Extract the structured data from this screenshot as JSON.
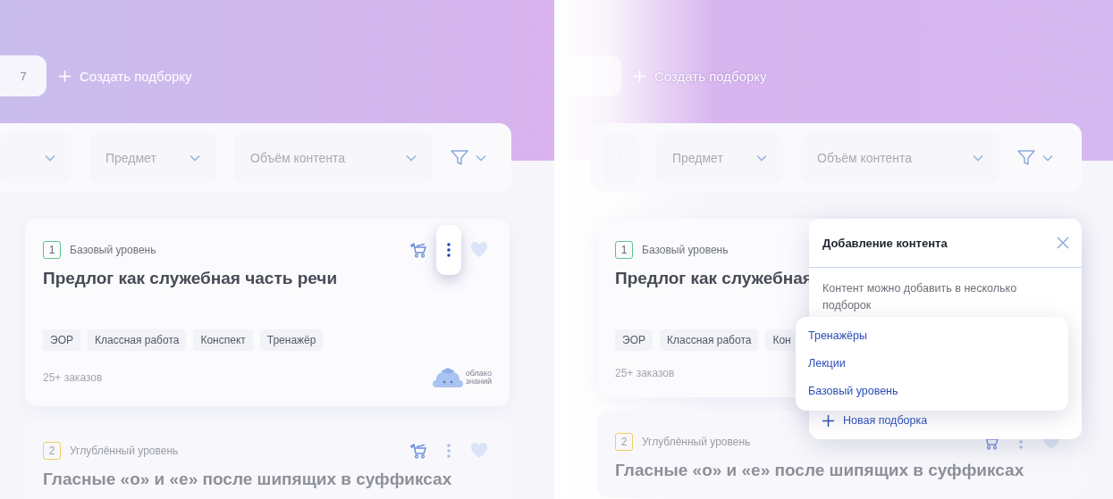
{
  "panels": [
    {
      "header": {
        "count": "7",
        "create_label": "Создать подборку"
      },
      "filters": [
        {
          "kind": "select"
        },
        {
          "kind": "select",
          "label": "Предмет"
        },
        {
          "kind": "select",
          "label": "Объём контента"
        },
        {
          "kind": "filter"
        }
      ],
      "cards": [
        {
          "number": "1",
          "color": "#5cc48a",
          "level": "Базовый уровень",
          "title": "Предлог как служебная часть речи",
          "tags": [
            "ЭОР",
            "Классная работа",
            "Конспект",
            "Тренажёр"
          ],
          "orders": "25+ заказов",
          "logo": [
            "облако",
            "знаний"
          ],
          "actions": true,
          "menu_open": true,
          "dimmed": false
        },
        {
          "number": "2",
          "color": "#f0d060",
          "level": "Углублённый уровень",
          "title": "Гласные «о» и «е» после шипящих в суффиксах",
          "actions": true,
          "menu_open": false,
          "dimmed": true
        }
      ]
    },
    {
      "header": {
        "create_label": "Создать подборку"
      },
      "filters": [
        {
          "kind": "select"
        },
        {
          "kind": "select",
          "label": "Предмет"
        },
        {
          "kind": "select",
          "label": "Объём контента"
        },
        {
          "kind": "filter"
        }
      ],
      "cards": [
        {
          "number": "1",
          "color": "#5cc48a",
          "level": "Базовый уровень",
          "title": "Предлог как служебная",
          "tags": [
            "ЭОР",
            "Классная работа",
            "Кон"
          ],
          "orders": "25+ заказов",
          "dimmed": false
        },
        {
          "number": "2",
          "color": "#f0d060",
          "level": "Углублённый уровень",
          "title": "Гласные «о» и «е» после шипящих в суффиксах",
          "actions": true,
          "menu_open": false,
          "dimmed": true
        }
      ],
      "popup": {
        "title": "Добавление контента",
        "text": "Контент можно добавить в несколько подборок",
        "options": [
          "Тренажёры",
          "Лекции",
          "Базовый уровень"
        ],
        "new_label": "Новая подборка"
      }
    }
  ]
}
